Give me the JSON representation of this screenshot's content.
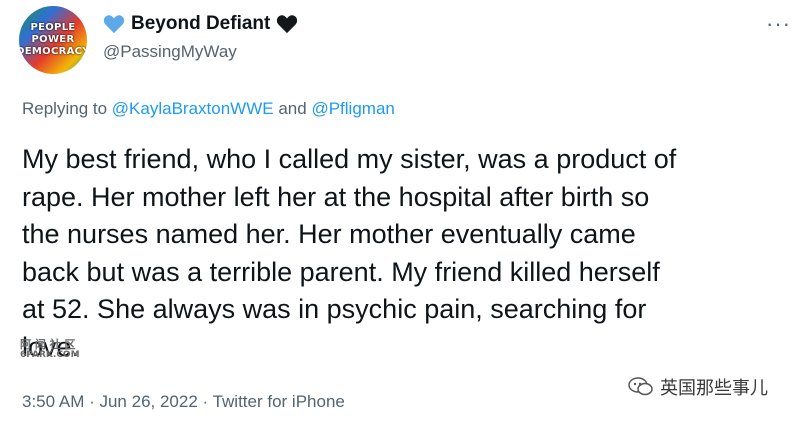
{
  "avatar": {
    "lines": [
      "PEOPLE",
      "POWER",
      "DEMOCRACY"
    ]
  },
  "author": {
    "display_name": "Beyond Defiant",
    "handle": "@PassingMyWay",
    "colors": {
      "heart_left": "#5da8e8",
      "heart_right": "#14171a"
    }
  },
  "reply": {
    "prefix": "Replying to",
    "user1": "@KaylaBraxtonWWE",
    "connector": "and",
    "user2": "@Pfligman"
  },
  "tweet": {
    "text": "My best friend, who I called my sister, was a product of\nrape. Her mother left her at the hospital after birth so\nthe nurses named her. Her mother eventually came\nback but was a terrible parent. My friend killed herself\nat 52. She always was in psychic pain, searching for\nlove."
  },
  "meta": {
    "timestamp": "3:50 AM · Jun 26, 2022 · Twitter for iPhone"
  },
  "watermarks": {
    "left_cn": "阿 闻 社 区",
    "left_en": "6PARK.COM",
    "right_text": "英国那些事儿"
  },
  "icons": {
    "more": "more-options-icon"
  }
}
